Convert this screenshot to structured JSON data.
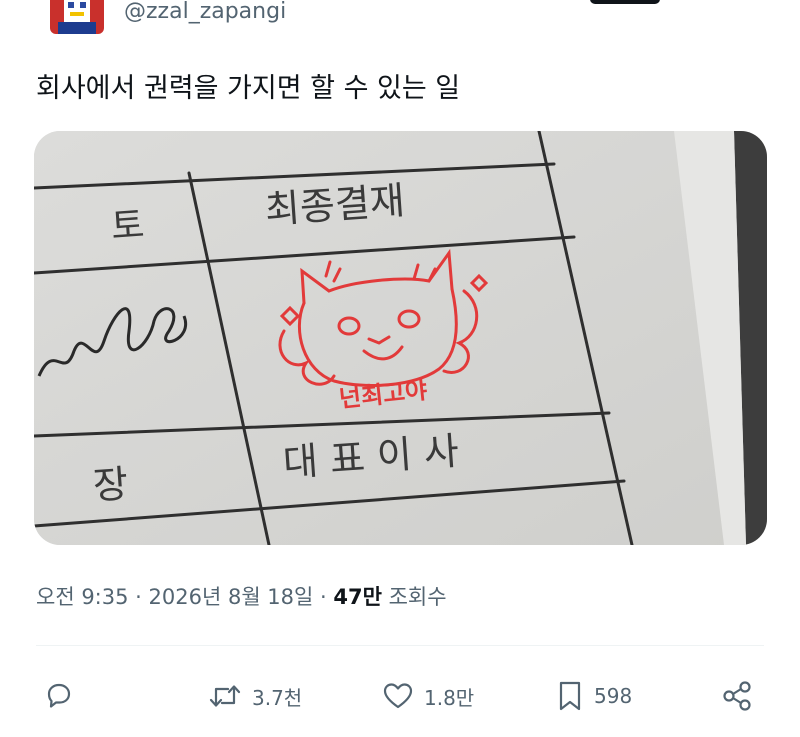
{
  "author": {
    "handle": "@zzal_zapangi",
    "avatar_icon": "robot-avatar-icon"
  },
  "tweet": {
    "text": "회사에서 권력을 가지면 할 수 있는 일"
  },
  "media": {
    "image_text": {
      "col_left_top": "토",
      "col_left_bottom": "장",
      "header_right": "최종결재",
      "footer_right": "대 표 이 사",
      "stamp_caption": "넌최고야"
    }
  },
  "meta": {
    "time": "오전 9:35",
    "sep1": " · ",
    "date": "2026년 8월 18일",
    "sep2": " · ",
    "views_count": "47만",
    "views_label": " 조회수"
  },
  "actions": {
    "reply": {
      "icon": "reply-icon"
    },
    "retweet": {
      "icon": "retweet-icon",
      "count": "3.7천"
    },
    "like": {
      "icon": "heart-icon",
      "count": "1.8만"
    },
    "bookmark": {
      "icon": "bookmark-icon",
      "count": "598"
    },
    "share": {
      "icon": "share-icon"
    }
  },
  "colors": {
    "stamp_red": "#e23a3a",
    "muted": "#536471",
    "text": "#0f1419"
  }
}
